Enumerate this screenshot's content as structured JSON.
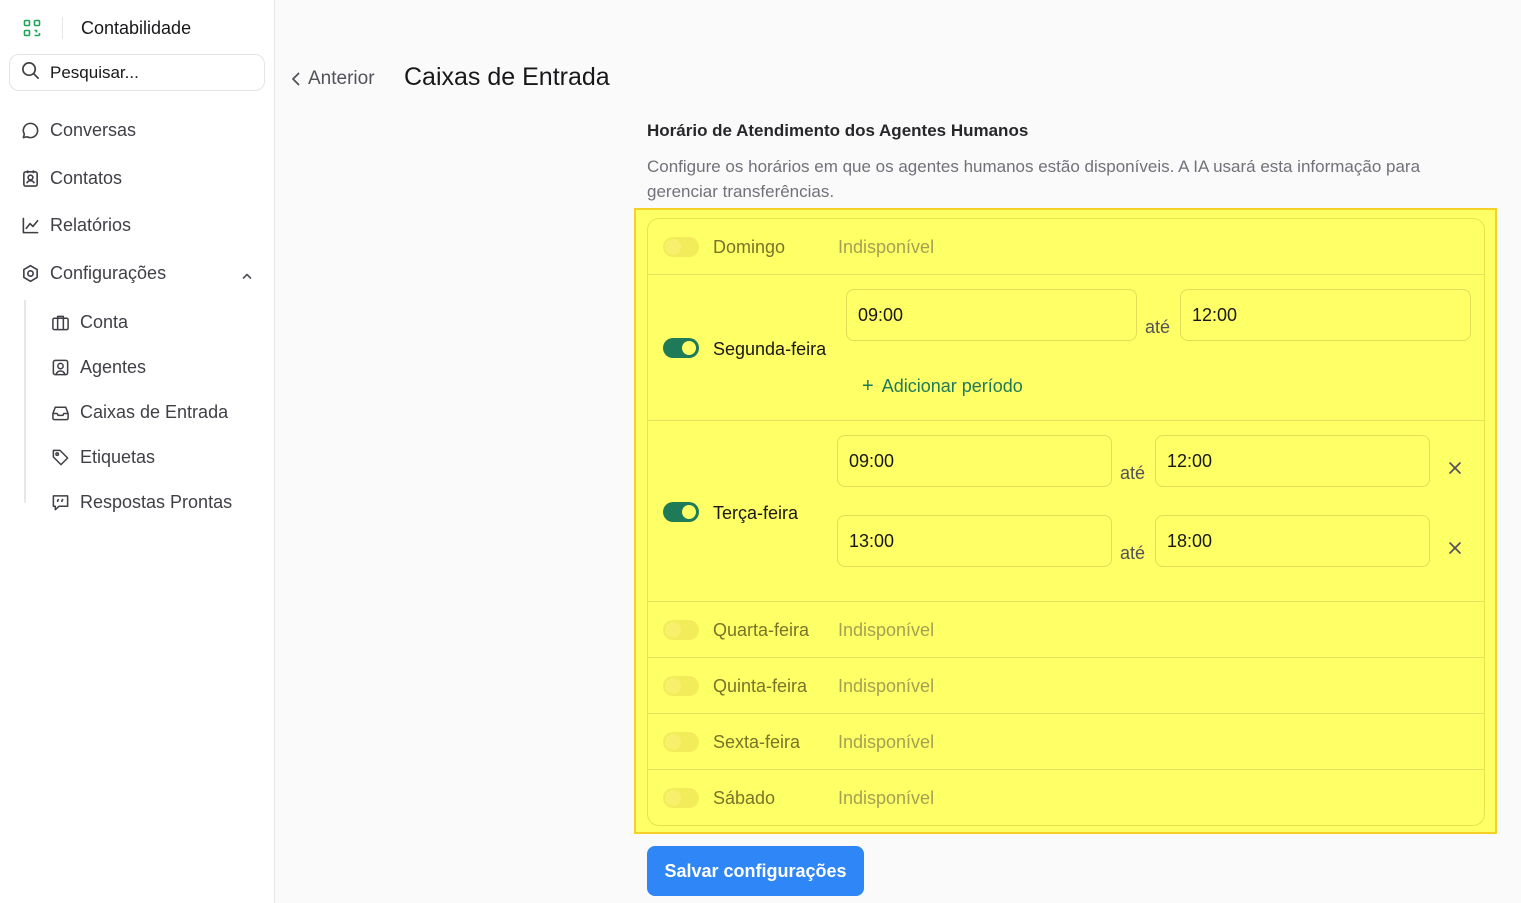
{
  "app": {
    "name": "Contabilidade"
  },
  "search": {
    "placeholder": "Pesquisar..."
  },
  "sidebar": {
    "items": [
      {
        "label": "Conversas",
        "icon": "chat-bubble-icon"
      },
      {
        "label": "Contatos",
        "icon": "contact-card-icon"
      },
      {
        "label": "Relatórios",
        "icon": "line-chart-icon"
      },
      {
        "label": "Configurações",
        "icon": "settings-icon",
        "expanded": true
      }
    ],
    "subitems": [
      {
        "label": "Conta",
        "icon": "briefcase-icon"
      },
      {
        "label": "Agentes",
        "icon": "user-square-icon"
      },
      {
        "label": "Caixas de Entrada",
        "icon": "inbox-icon"
      },
      {
        "label": "Etiquetas",
        "icon": "tag-icon"
      },
      {
        "label": "Respostas Prontas",
        "icon": "quote-message-icon"
      }
    ]
  },
  "header": {
    "back_label": "Anterior",
    "title": "Caixas de Entrada"
  },
  "section": {
    "title": "Horário de Atendimento dos Agentes Humanos",
    "description": "Configure os horários em que os agentes humanos estão disponíveis. A IA usará esta informação para gerenciar transferências."
  },
  "schedule": {
    "unavailable_label": "Indisponível",
    "until_label": "até",
    "add_period_label": "Adicionar período",
    "days": [
      {
        "name": "Domingo",
        "enabled": false,
        "periods": []
      },
      {
        "name": "Segunda-feira",
        "enabled": true,
        "periods": [
          {
            "start": "09:00",
            "end": "12:00"
          }
        ]
      },
      {
        "name": "Terça-feira",
        "enabled": true,
        "periods": [
          {
            "start": "09:00",
            "end": "12:00"
          },
          {
            "start": "13:00",
            "end": "18:00"
          }
        ]
      },
      {
        "name": "Quarta-feira",
        "enabled": false,
        "periods": []
      },
      {
        "name": "Quinta-feira",
        "enabled": false,
        "periods": []
      },
      {
        "name": "Sexta-feira",
        "enabled": false,
        "periods": []
      },
      {
        "name": "Sábado",
        "enabled": false,
        "periods": []
      }
    ]
  },
  "actions": {
    "save_label": "Salvar configurações"
  },
  "colors": {
    "accent_green": "#1f7a58",
    "primary_blue": "#2f86f6",
    "highlight_yellow": "#ffff66"
  }
}
